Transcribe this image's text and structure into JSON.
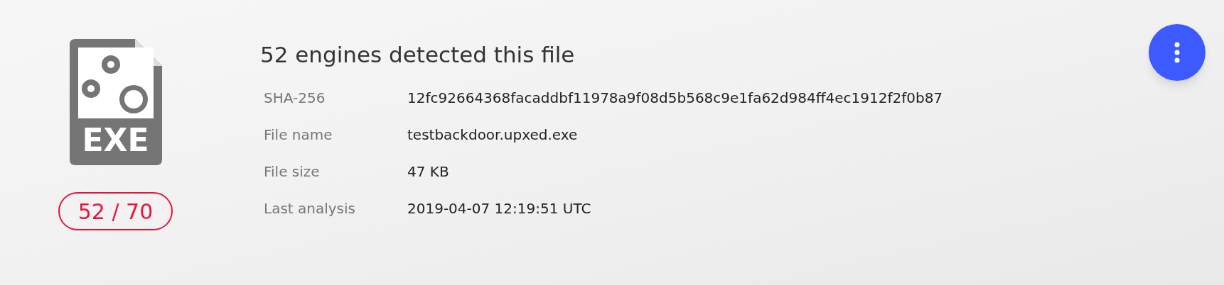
{
  "file_icon": {
    "label": "EXE"
  },
  "detection_badge": {
    "text": "52 / 70"
  },
  "title": "52 engines detected this file",
  "details": [
    {
      "label": "SHA-256",
      "value": "12fc92664368facaddbf11978a9f08d5b568c9e1fa62d984ff4ec1912f2f0b87"
    },
    {
      "label": "File name",
      "value": "testbackdoor.upxed.exe"
    },
    {
      "label": "File size",
      "value": "47 KB"
    },
    {
      "label": "Last analysis",
      "value": "2019-04-07 12:19:51 UTC"
    }
  ]
}
